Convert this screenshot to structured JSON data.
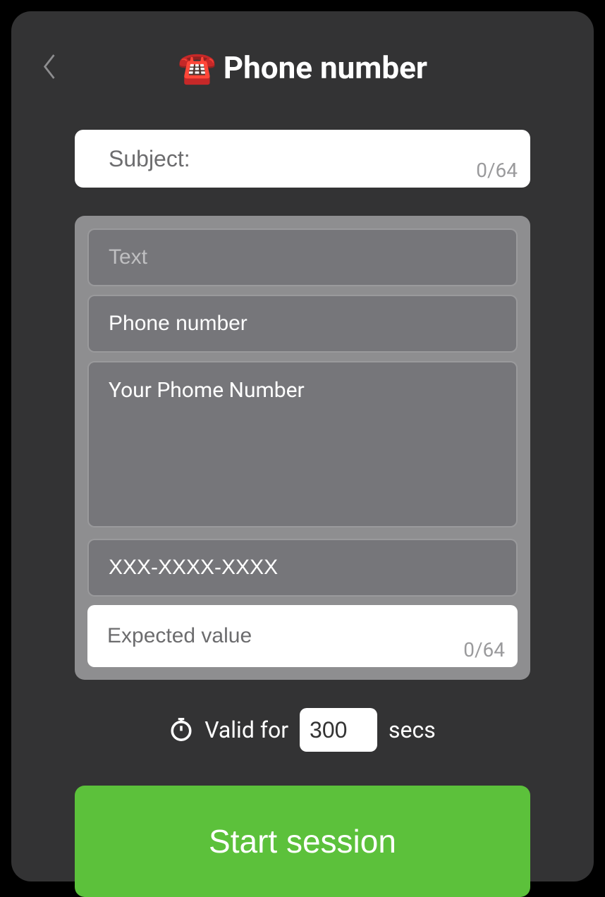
{
  "header": {
    "icon": "☎️",
    "title": "Phone number"
  },
  "subject": {
    "placeholder": "Subject:",
    "value": "",
    "counter": "0/64"
  },
  "group": {
    "text_field": {
      "value": "Text"
    },
    "phone_label_field": {
      "value": "Phone number"
    },
    "phone_desc_field": {
      "value": "Your Phome Number"
    },
    "format_field": {
      "value": "XXX-XXXX-XXXX"
    },
    "expected": {
      "placeholder": "Expected value",
      "value": "",
      "counter": "0/64"
    }
  },
  "valid": {
    "label_before": "Valid for",
    "value": "300",
    "label_after": "secs"
  },
  "start_button": "Start session"
}
